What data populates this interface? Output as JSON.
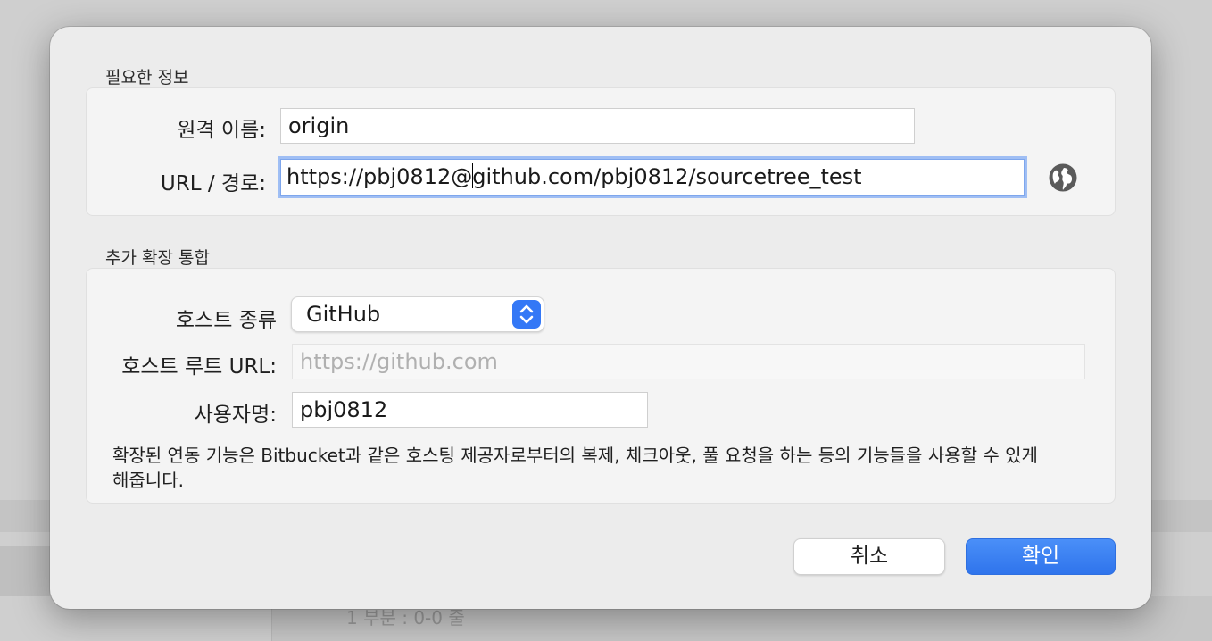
{
  "background": {
    "status_text": "1 부분 : 0-0 줄"
  },
  "dialog": {
    "required_section": {
      "title": "필요한 정보",
      "remote_name_label": "원격 이름:",
      "remote_name_value": "origin",
      "url_label": "URL / 경로:",
      "url_value_before_caret": "https://pbj0812@",
      "url_value_after_caret": "github.com/pbj0812/sourcetree_test",
      "browse_icon": "globe-icon"
    },
    "extended_section": {
      "title": "추가 확장 통합",
      "host_type_label": "호스트 종류",
      "host_type_value": "GitHub",
      "host_root_url_label": "호스트 루트 URL:",
      "host_root_url_placeholder": "https://github.com",
      "username_label": "사용자명:",
      "username_value": "pbj0812",
      "description": "확장된 연동 기능은 Bitbucket과 같은 호스팅 제공자로부터의 복제, 체크아웃, 풀 요청을 하는 등의 기능들을 사용할 수 있게 해줍니다."
    },
    "buttons": {
      "cancel_label": "취소",
      "ok_label": "확인"
    }
  },
  "colors": {
    "accent": "#3478f6",
    "focus_ring": "#9fbef4"
  }
}
